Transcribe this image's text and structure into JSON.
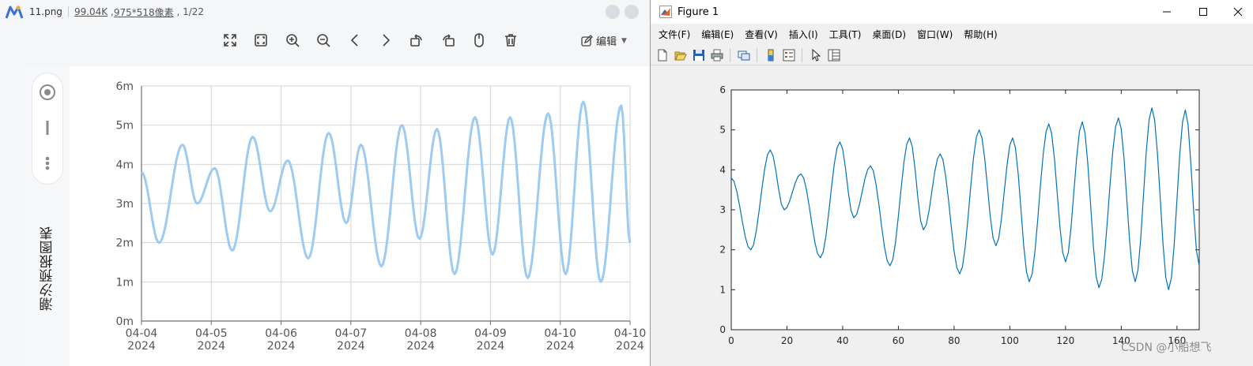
{
  "viewer": {
    "file_name": "11.png",
    "file_size": "99.04K",
    "dimensions": "975*518像素",
    "position": "1/22",
    "edit_label": "编辑",
    "side_title": "潮汐预报图表",
    "toolbar_icons": [
      "fullscreen-icon",
      "fit-icon",
      "zoom-in-icon",
      "zoom-out-icon",
      "prev-icon",
      "next-icon",
      "rotate-left-icon",
      "rotate-right-icon",
      "mouse-icon",
      "delete-icon"
    ]
  },
  "figure": {
    "title": "Figure 1",
    "menu": [
      "文件(F)",
      "编辑(E)",
      "查看(V)",
      "插入(I)",
      "工具(T)",
      "桌面(D)",
      "窗口(W)",
      "帮助(H)"
    ],
    "toolbar_icons": [
      "new-icon",
      "open-icon",
      "save-icon",
      "print-icon",
      "link-icon",
      "colorbar-icon",
      "legend-icon",
      "select-icon",
      "property-icon"
    ]
  },
  "watermark": "CSDN @小船想飞",
  "chart_data": [
    {
      "type": "line",
      "title": "潮汐预报图表",
      "color": "#9ecbf1",
      "x_ticks": [
        [
          "04-04",
          "2024"
        ],
        [
          "04-05",
          "2024"
        ],
        [
          "04-06",
          "2024"
        ],
        [
          "04-07",
          "2024"
        ],
        [
          "04-08",
          "2024"
        ],
        [
          "04-09",
          "2024"
        ],
        [
          "04-10",
          "2024"
        ],
        [
          "04-10",
          "2024"
        ]
      ],
      "y_ticks": [
        "0m",
        "1m",
        "2m",
        "3m",
        "4m",
        "5m",
        "6m"
      ],
      "ylim": [
        0,
        6
      ],
      "xlim": [
        0,
        167
      ],
      "grid": true,
      "extrema": [
        [
          0,
          3.8
        ],
        [
          6,
          2.0
        ],
        [
          14,
          4.5
        ],
        [
          19,
          3.0
        ],
        [
          25,
          3.9
        ],
        [
          31,
          1.8
        ],
        [
          38,
          4.7
        ],
        [
          44,
          2.8
        ],
        [
          50,
          4.1
        ],
        [
          57,
          1.6
        ],
        [
          64,
          4.8
        ],
        [
          70,
          2.5
        ],
        [
          75,
          4.5
        ],
        [
          82,
          1.4
        ],
        [
          89,
          5.0
        ],
        [
          95,
          2.1
        ],
        [
          101,
          4.9
        ],
        [
          107,
          1.2
        ],
        [
          114,
          5.2
        ],
        [
          120,
          1.7
        ],
        [
          126,
          5.2
        ],
        [
          132,
          1.1
        ],
        [
          139,
          5.3
        ],
        [
          145,
          1.2
        ],
        [
          151,
          5.6
        ],
        [
          157,
          1.0
        ],
        [
          164,
          5.5
        ],
        [
          167,
          2.0
        ]
      ]
    },
    {
      "type": "line",
      "color": "#0072bd",
      "x_ticks": [
        "0",
        "20",
        "40",
        "60",
        "80",
        "100",
        "120",
        "140",
        "160"
      ],
      "y_ticks": [
        "0",
        "1",
        "2",
        "3",
        "4",
        "5",
        "6"
      ],
      "xlim": [
        0,
        168
      ],
      "ylim": [
        0,
        6
      ],
      "grid": false,
      "extrema": [
        [
          0,
          3.8
        ],
        [
          7,
          2.0
        ],
        [
          14,
          4.5
        ],
        [
          19,
          3.0
        ],
        [
          25,
          3.9
        ],
        [
          32,
          1.8
        ],
        [
          39,
          4.7
        ],
        [
          44,
          2.8
        ],
        [
          50,
          4.1
        ],
        [
          57,
          1.6
        ],
        [
          64,
          4.8
        ],
        [
          69,
          2.5
        ],
        [
          75,
          4.4
        ],
        [
          82,
          1.4
        ],
        [
          89,
          5.0
        ],
        [
          95,
          2.1
        ],
        [
          101,
          4.8
        ],
        [
          107,
          1.2
        ],
        [
          114,
          5.15
        ],
        [
          120,
          1.7
        ],
        [
          126,
          5.2
        ],
        [
          132,
          1.05
        ],
        [
          139,
          5.3
        ],
        [
          145,
          1.2
        ],
        [
          151,
          5.55
        ],
        [
          157,
          1.0
        ],
        [
          163,
          5.5
        ],
        [
          168,
          1.6
        ]
      ]
    }
  ]
}
